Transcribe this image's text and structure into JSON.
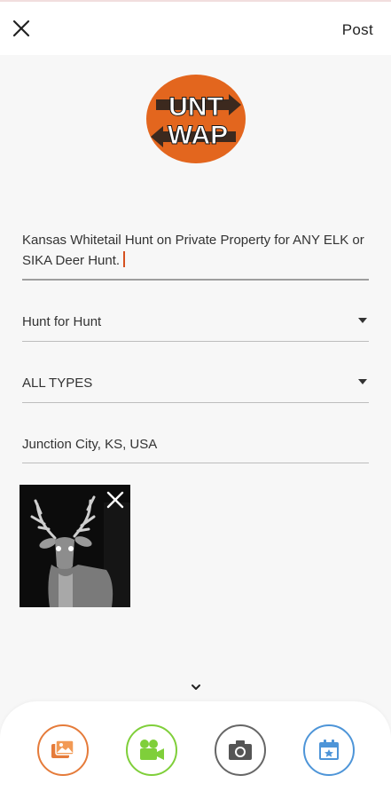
{
  "header": {
    "post_label": "Post"
  },
  "brand": {
    "logo_text_top": "HUNT",
    "logo_text_bottom": "SWAP",
    "accent_color": "#e3661e"
  },
  "form": {
    "title_value": "Kansas Whitetail Hunt on Private Property for ANY ELK or SIKA Deer Hunt.",
    "trade_type_value": "Hunt for Hunt",
    "hunt_types_value": "ALL TYPES",
    "location_value": "Junction City, KS, USA"
  },
  "attachments": [
    {
      "kind": "photo",
      "subject": "whitetail buck trail camera"
    }
  ],
  "toolbar": {
    "buttons": [
      {
        "icon": "gallery-icon",
        "color": "#e57b3a"
      },
      {
        "icon": "video-camera-icon",
        "color": "#7fcf3a"
      },
      {
        "icon": "camera-icon",
        "color": "#555555"
      },
      {
        "icon": "calendar-icon",
        "color": "#4e95d8"
      }
    ]
  }
}
